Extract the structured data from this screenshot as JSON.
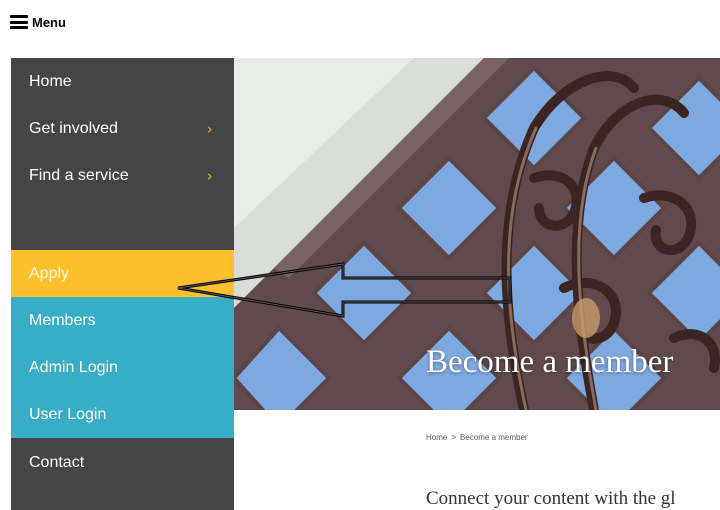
{
  "header": {
    "menu_label": "Menu"
  },
  "sidebar": {
    "items": [
      {
        "label": "Home",
        "has_submenu": false
      },
      {
        "label": "Get involved",
        "has_submenu": true
      },
      {
        "label": "Find a service",
        "has_submenu": true
      },
      {
        "label": "",
        "has_submenu": false
      },
      {
        "label": "Apply",
        "has_submenu": false
      },
      {
        "label": "Members",
        "has_submenu": false
      },
      {
        "label": "Admin Login",
        "has_submenu": false
      },
      {
        "label": "User Login",
        "has_submenu": false
      },
      {
        "label": "Contact",
        "has_submenu": false
      }
    ],
    "chevron": "›"
  },
  "hero": {
    "title": "Become a member"
  },
  "breadcrumb": {
    "home": "Home",
    "separator": ">",
    "current": "Become a member"
  },
  "main": {
    "intro_text": "Connect your content with the gl"
  },
  "colors": {
    "sidebar_bg": "#454545",
    "apply_bg": "#fcc02c",
    "teal_bg": "#37adc6",
    "chevron": "#f3b51c"
  },
  "icons": {
    "menu": "hamburger-icon",
    "submenu": "chevron-right-icon",
    "pointer": "arrow-left-icon"
  }
}
